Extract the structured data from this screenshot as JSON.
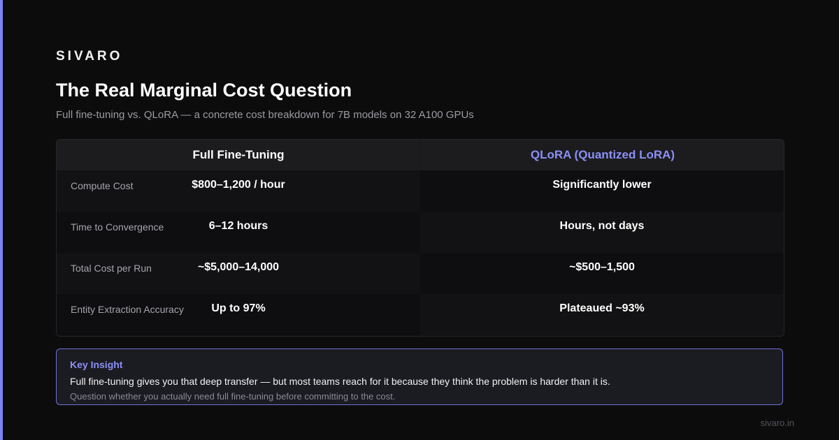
{
  "brand": "SIVARO",
  "title": "The Real Marginal Cost Question",
  "subtitle": "Full fine-tuning vs. QLoRA — a concrete cost breakdown for 7B models on 32 A100 GPUs",
  "table": {
    "headers": {
      "full": "Full Fine-Tuning",
      "qlora": "QLoRA (Quantized LoRA)"
    },
    "rows": [
      {
        "label": "Compute Cost",
        "full": "$800–1,200 / hour",
        "qlora": "Significantly lower"
      },
      {
        "label": "Time to Convergence",
        "full": "6–12 hours",
        "qlora": "Hours, not days"
      },
      {
        "label": "Total Cost per Run",
        "full": "~$5,000–14,000",
        "qlora": "~$500–1,500"
      },
      {
        "label": "Entity Extraction Accuracy",
        "full": "Up to 97%",
        "qlora": "Plateaued ~93%"
      }
    ]
  },
  "insight": {
    "title": "Key Insight",
    "main": "Full fine-tuning gives you that deep transfer — but most teams reach for it because they think the problem is harder than it is.",
    "note": "Question whether you actually need full fine-tuning before committing to the cost."
  },
  "footer": "sivaro.in",
  "colors": {
    "accent": "#7c83f2",
    "background": "#0c0c0d"
  }
}
